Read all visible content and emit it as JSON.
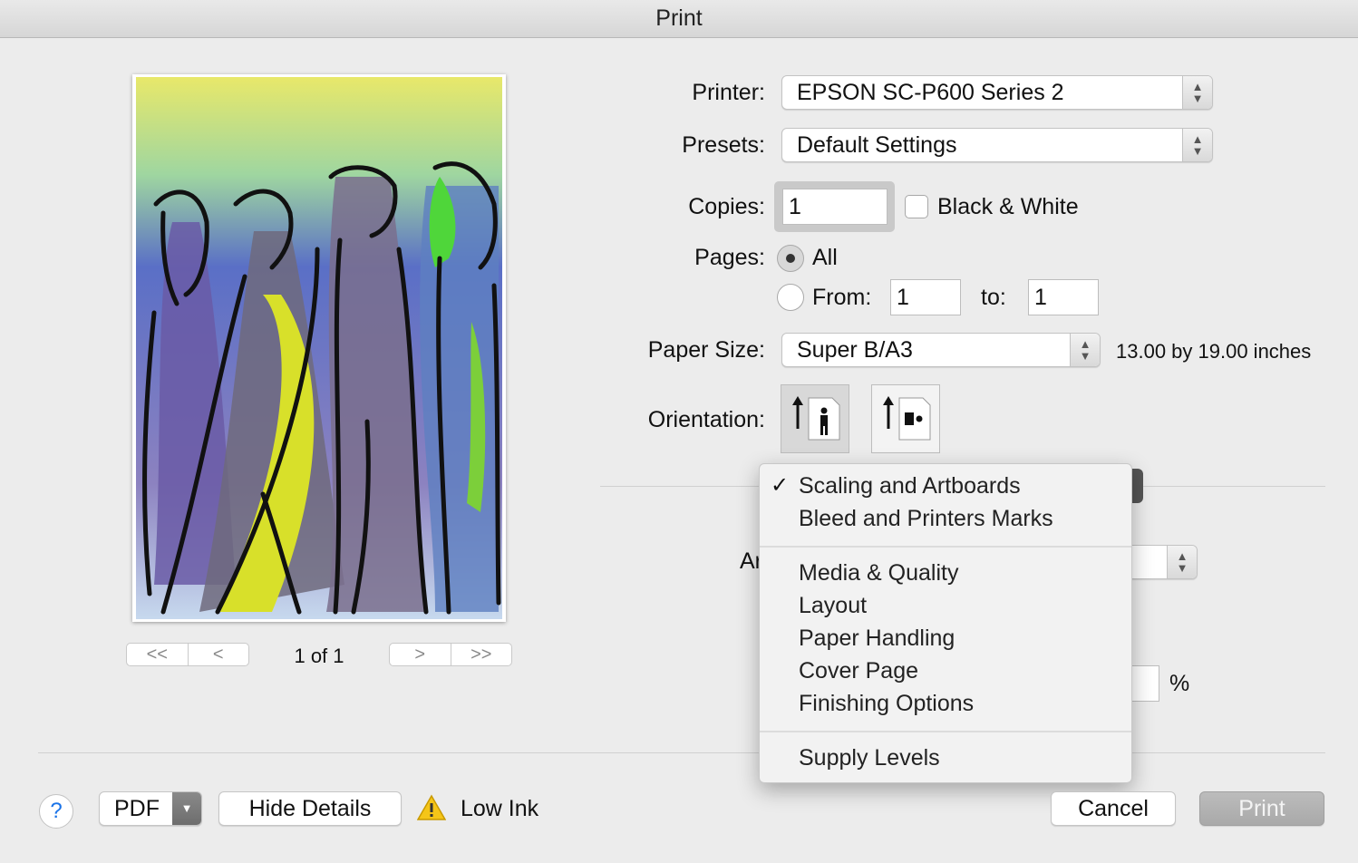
{
  "window": {
    "title": "Print"
  },
  "preview": {
    "page_indicator": "1 of 1",
    "nav": {
      "first": "<<",
      "prev": "<",
      "next": ">",
      "last": ">>"
    }
  },
  "form": {
    "printer": {
      "label": "Printer:",
      "value": "EPSON SC-P600 Series 2"
    },
    "presets": {
      "label": "Presets:",
      "value": "Default Settings"
    },
    "copies": {
      "label": "Copies:",
      "value": "1",
      "bw_label": "Black & White",
      "bw_checked": false
    },
    "pages": {
      "label": "Pages:",
      "all_label": "All",
      "all_selected": true,
      "from_label": "From:",
      "from_value": "1",
      "to_label": "to:",
      "to_value": "1"
    },
    "paper_size": {
      "label": "Paper Size:",
      "value": "Super B/A3",
      "dimensions": "13.00 by 19.00 inches"
    },
    "orientation": {
      "label": "Orientation:",
      "selected": "portrait"
    },
    "partial_label": "Ar",
    "percent_sign": "%"
  },
  "dropdown_menu": {
    "groups": [
      [
        {
          "label": "Scaling and Artboards",
          "checked": true
        },
        {
          "label": "Bleed and Printers Marks",
          "checked": false
        }
      ],
      [
        {
          "label": "Media & Quality"
        },
        {
          "label": "Layout"
        },
        {
          "label": "Paper Handling"
        },
        {
          "label": "Cover Page"
        },
        {
          "label": "Finishing Options"
        }
      ],
      [
        {
          "label": "Supply Levels"
        }
      ]
    ]
  },
  "footer": {
    "help": "?",
    "pdf": "PDF",
    "hide_details": "Hide Details",
    "low_ink": "Low Ink",
    "cancel": "Cancel",
    "print": "Print"
  },
  "colors": {
    "background": "#ececec",
    "menu_bg": "#f2f2f2",
    "print_button_disabled": "#b3b3b3",
    "help_blue": "#1a73e8"
  }
}
